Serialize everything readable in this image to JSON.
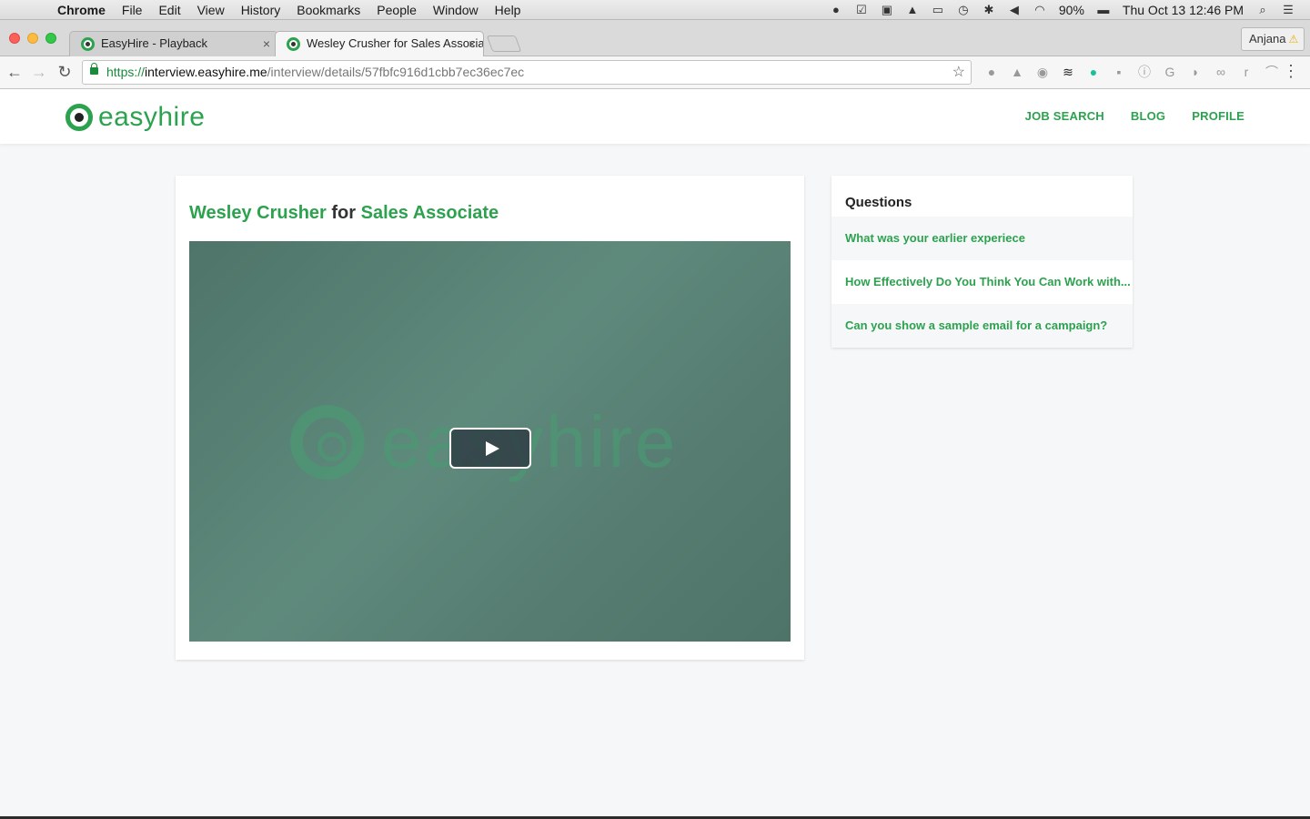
{
  "menubar": {
    "app": "Chrome",
    "items": [
      "File",
      "Edit",
      "View",
      "History",
      "Bookmarks",
      "People",
      "Window",
      "Help"
    ],
    "battery": "90%",
    "clock": "Thu Oct 13  12:46 PM"
  },
  "tabs": [
    {
      "title": "EasyHire - Playback",
      "close": "×"
    },
    {
      "title": "Wesley Crusher for Sales Associate",
      "close": "×"
    }
  ],
  "profile": {
    "name": "Anjana",
    "warning": "⚠"
  },
  "address": {
    "scheme": "https://",
    "host": "interview.easyhire.me",
    "path": "/interview/details/57fbfc916d1cbb7ec36ec7ec"
  },
  "site": {
    "logo": "easyhire",
    "nav": [
      "JOB SEARCH",
      "BLOG",
      "PROFILE"
    ]
  },
  "interview": {
    "candidate": "Wesley Crusher",
    "connector": "for",
    "position": "Sales Associate",
    "video_watermark": "easyhire"
  },
  "questions": {
    "heading": "Questions",
    "items": [
      "What was your earlier experiece",
      "How Effectively Do You Think You Can Work with...",
      "Can you show a sample email for a campaign?"
    ]
  },
  "colors": {
    "brand_green": "#2ca24f",
    "video_bg": "#5a8376"
  }
}
